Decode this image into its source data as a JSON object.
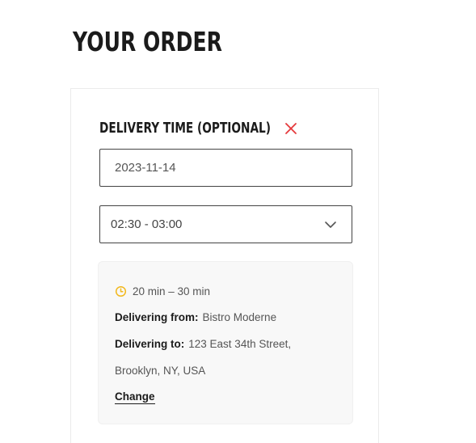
{
  "page": {
    "title": "YOUR ORDER"
  },
  "delivery_time": {
    "title": "DELIVERY TIME (OPTIONAL)",
    "close_icon": "close-icon",
    "date_value": "2023-11-14",
    "time_value": "02:30 - 03:00",
    "dropdown_icon": "chevron-down-icon"
  },
  "delivery_info": {
    "eta_icon": "clock-icon",
    "eta": "20 min – 30 min",
    "from_label": "Delivering from:",
    "from_value": "Bistro Moderne",
    "to_label": "Delivering to:",
    "to_value_line1": "123 East 34th Street,",
    "to_value_line2": "Brooklyn, NY, USA",
    "change_label": "Change"
  },
  "colors": {
    "close_icon": "#e5383b",
    "clock_icon": "#f2b81c",
    "text_dark": "#1b1b1b",
    "text_muted": "#555555"
  }
}
